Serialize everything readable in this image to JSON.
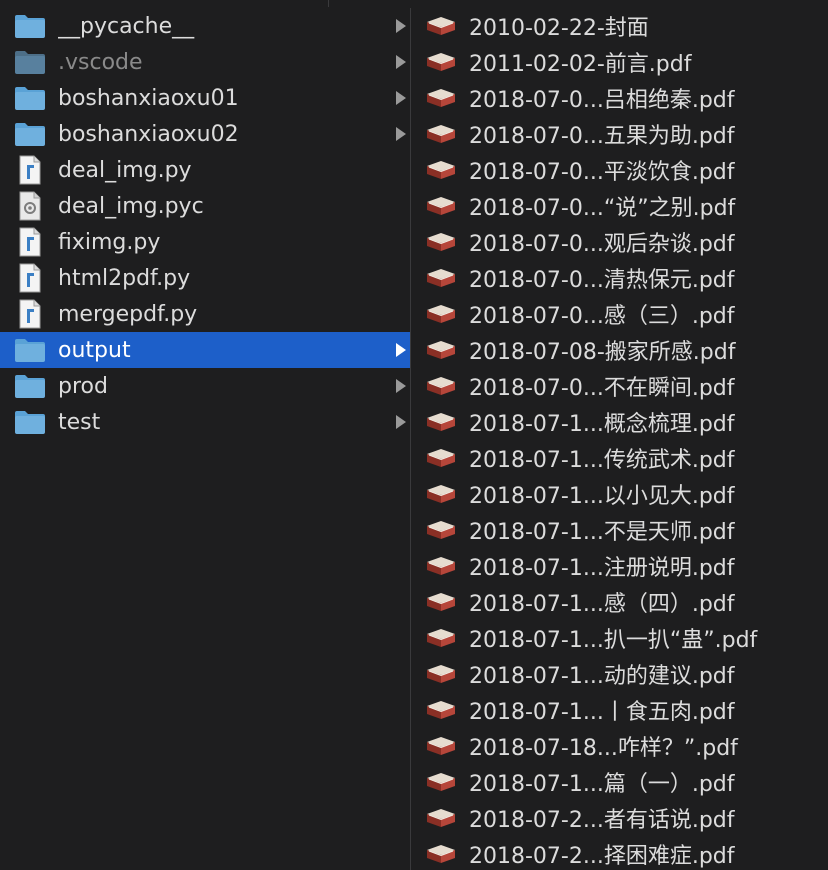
{
  "left_column": {
    "items": [
      {
        "label": "__pycache__",
        "type": "folder",
        "icon": "folder-icon",
        "has_children": true,
        "dim": false,
        "selected": false
      },
      {
        "label": ".vscode",
        "type": "folder",
        "icon": "folder-icon",
        "has_children": true,
        "dim": true,
        "selected": false
      },
      {
        "label": "boshanxiaoxu01",
        "type": "folder",
        "icon": "folder-icon",
        "has_children": true,
        "dim": false,
        "selected": false
      },
      {
        "label": "boshanxiaoxu02",
        "type": "folder",
        "icon": "folder-icon",
        "has_children": true,
        "dim": false,
        "selected": false
      },
      {
        "label": "deal_img.py",
        "type": "py",
        "icon": "python-file-icon",
        "has_children": false,
        "dim": false,
        "selected": false
      },
      {
        "label": "deal_img.pyc",
        "type": "pyc",
        "icon": "compiled-python-file-icon",
        "has_children": false,
        "dim": false,
        "selected": false
      },
      {
        "label": "fiximg.py",
        "type": "py",
        "icon": "python-file-icon",
        "has_children": false,
        "dim": false,
        "selected": false
      },
      {
        "label": "html2pdf.py",
        "type": "py",
        "icon": "python-file-icon",
        "has_children": false,
        "dim": false,
        "selected": false
      },
      {
        "label": "mergepdf.py",
        "type": "py",
        "icon": "python-file-icon",
        "has_children": false,
        "dim": false,
        "selected": false
      },
      {
        "label": "output",
        "type": "folder",
        "icon": "folder-icon",
        "has_children": true,
        "dim": false,
        "selected": true
      },
      {
        "label": "prod",
        "type": "folder",
        "icon": "folder-icon",
        "has_children": true,
        "dim": false,
        "selected": false
      },
      {
        "label": "test",
        "type": "folder",
        "icon": "folder-icon",
        "has_children": true,
        "dim": false,
        "selected": false
      }
    ]
  },
  "right_column": {
    "items": [
      {
        "label": "2010-02-22-封面",
        "icon": "book-icon"
      },
      {
        "label": "2011-02-02-前言.pdf",
        "icon": "book-icon"
      },
      {
        "label": "2018-07-0...吕相绝秦.pdf",
        "icon": "book-icon"
      },
      {
        "label": "2018-07-0...五果为助.pdf",
        "icon": "book-icon"
      },
      {
        "label": "2018-07-0...平淡饮食.pdf",
        "icon": "book-icon"
      },
      {
        "label": "2018-07-0...“说”之别.pdf",
        "icon": "book-icon"
      },
      {
        "label": "2018-07-0...观后杂谈.pdf",
        "icon": "book-icon"
      },
      {
        "label": "2018-07-0...清热保元.pdf",
        "icon": "book-icon"
      },
      {
        "label": "2018-07-0...感（三）.pdf",
        "icon": "book-icon"
      },
      {
        "label": "2018-07-08-搬家所感.pdf",
        "icon": "book-icon"
      },
      {
        "label": "2018-07-0...不在瞬间.pdf",
        "icon": "book-icon"
      },
      {
        "label": "2018-07-1...概念梳理.pdf",
        "icon": "book-icon"
      },
      {
        "label": "2018-07-1...传统武术.pdf",
        "icon": "book-icon"
      },
      {
        "label": "2018-07-1...以小见大.pdf",
        "icon": "book-icon"
      },
      {
        "label": "2018-07-1...不是天师.pdf",
        "icon": "book-icon"
      },
      {
        "label": "2018-07-1...注册说明.pdf",
        "icon": "book-icon"
      },
      {
        "label": "2018-07-1...感（四）.pdf",
        "icon": "book-icon"
      },
      {
        "label": "2018-07-1...扒一扒“蛊”.pdf",
        "icon": "book-icon"
      },
      {
        "label": "2018-07-1...动的建议.pdf",
        "icon": "book-icon"
      },
      {
        "label": "2018-07-1...丨食五肉.pdf",
        "icon": "book-icon"
      },
      {
        "label": "2018-07-18...咋样？”.pdf",
        "icon": "book-icon"
      },
      {
        "label": "2018-07-1...篇（一）.pdf",
        "icon": "book-icon"
      },
      {
        "label": "2018-07-2...者有话说.pdf",
        "icon": "book-icon"
      },
      {
        "label": "2018-07-2...择困难症.pdf",
        "icon": "book-icon"
      }
    ]
  },
  "colors": {
    "background": "#1e1e1f",
    "selection": "#1d5fc9",
    "folder": "#6fb0de",
    "text": "#dcdcdc",
    "dim_text": "#8a8a8a"
  }
}
